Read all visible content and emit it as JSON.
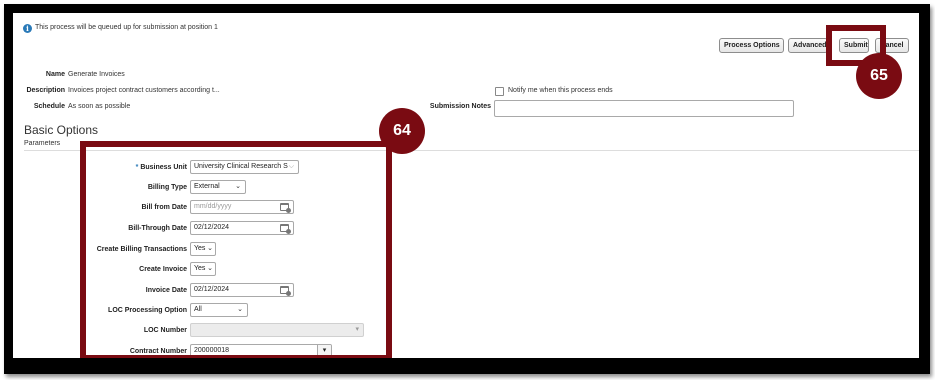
{
  "info_message": "This process will be queued up for submission at position 1",
  "toolbar": {
    "process_options": "Process Options",
    "advanced": "Advanced",
    "submit": "Submit",
    "cancel": "Cancel"
  },
  "process": {
    "name_label": "Name",
    "name_value": "Generate Invoices",
    "description_label": "Description",
    "description_value": "Invoices project contract customers according t...",
    "schedule_label": "Schedule",
    "schedule_value": "As soon as possible",
    "notify_label": "Notify me when this process ends",
    "submission_notes_label": "Submission Notes",
    "submission_notes_value": ""
  },
  "basic_options": {
    "heading": "Basic Options",
    "parameters_label": "Parameters"
  },
  "parameters": {
    "business_unit_label": "Business Unit",
    "business_unit_value": "University Clinical Research S",
    "billing_type_label": "Billing Type",
    "billing_type_value": "External",
    "bill_from_date_label": "Bill from Date",
    "bill_from_date_placeholder": "mm/dd/yyyy",
    "bill_through_date_label": "Bill-Through Date",
    "bill_through_date_value": "02/12/2024",
    "create_billing_transactions_label": "Create Billing Transactions",
    "create_billing_transactions_value": "Yes",
    "create_invoice_label": "Create Invoice",
    "create_invoice_value": "Yes",
    "invoice_date_label": "Invoice Date",
    "invoice_date_value": "02/12/2024",
    "loc_processing_option_label": "LOC Processing Option",
    "loc_processing_option_value": "All",
    "loc_number_label": "LOC Number",
    "loc_number_value": "",
    "contract_number_label": "Contract Number",
    "contract_number_value": "200000018"
  },
  "callouts": {
    "parameters_step": "64",
    "submit_step": "65"
  },
  "colors": {
    "callout": "#7a0b12",
    "info_icon": "#2a7ab8"
  },
  "icons": {
    "info": "info-icon",
    "calendar": "calendar-icon",
    "dropdown": "chevron-down-icon",
    "lookup": "search-lookup-icon"
  }
}
